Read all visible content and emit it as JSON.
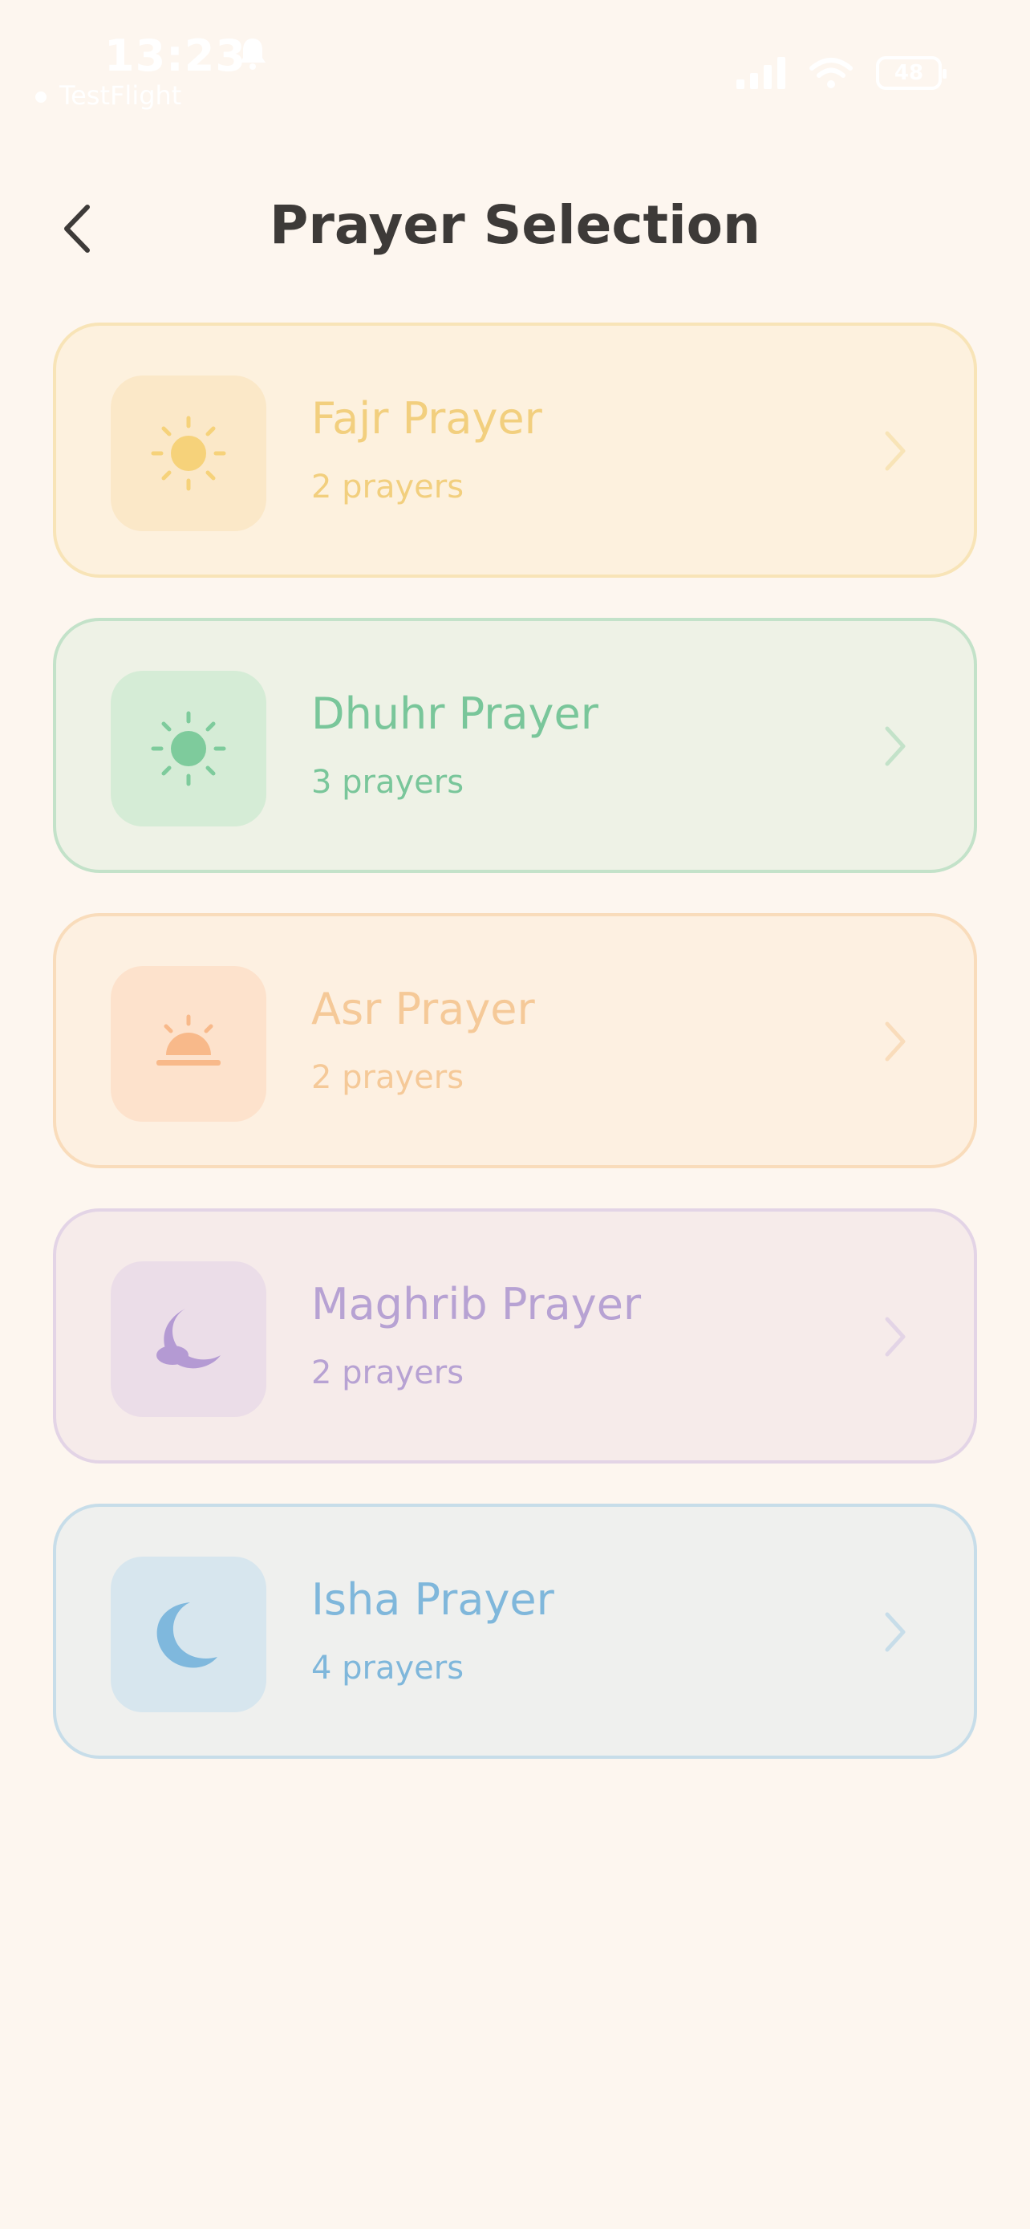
{
  "status_bar": {
    "time": "13:23",
    "source_app": "TestFlight",
    "battery": "48"
  },
  "header": {
    "title": "Prayer Selection"
  },
  "prayers": [
    {
      "name": "Fajr Prayer",
      "count": "2 prayers",
      "icon": "sun-icon",
      "text_color": "#f2cf7e",
      "border_color": "#f8e4b7",
      "bg_color": "#fdf1de",
      "icon_bg": "#fbe8c8",
      "icon_color": "#f6d27a"
    },
    {
      "name": "Dhuhr Prayer",
      "count": "3 prayers",
      "icon": "sun-icon",
      "text_color": "#79c69a",
      "border_color": "#c3e2c9",
      "bg_color": "#eef2e6",
      "icon_bg": "#d5ecd6",
      "icon_color": "#7ecb9c"
    },
    {
      "name": "Asr Prayer",
      "count": "2 prayers",
      "icon": "sunset-icon",
      "text_color": "#f5c998",
      "border_color": "#f9dcbb",
      "bg_color": "#fdf0e1",
      "icon_bg": "#fde2cc",
      "icon_color": "#f8b98a"
    },
    {
      "name": "Maghrib Prayer",
      "count": "2 prayers",
      "icon": "moon-cloud-icon",
      "text_color": "#b7a2d3",
      "border_color": "#e3d4e6",
      "bg_color": "#f6ebea",
      "icon_bg": "#ebdde8",
      "icon_color": "#b49ad3"
    },
    {
      "name": "Isha Prayer",
      "count": "4 prayers",
      "icon": "moon-icon",
      "text_color": "#7fb7db",
      "border_color": "#c7dde9",
      "bg_color": "#eff0ee",
      "icon_bg": "#d7e6ee",
      "icon_color": "#7fb8dd"
    }
  ]
}
